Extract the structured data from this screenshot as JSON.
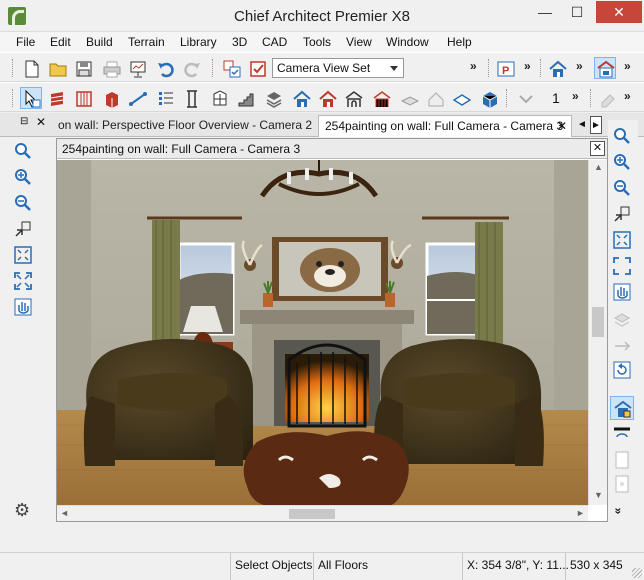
{
  "window": {
    "title": "Chief Architect Premier X8",
    "minimize": "—",
    "maximize": "☐",
    "close": "✕"
  },
  "menu": [
    "File",
    "Edit",
    "Build",
    "Terrain",
    "Library",
    "3D",
    "CAD",
    "Tools",
    "View",
    "Window",
    "Help"
  ],
  "toolbar": {
    "camera_view_set": "Camera View Set",
    "overflow": "»",
    "number": "1"
  },
  "tabs": {
    "tab1_label": "on wall: Perspective Floor Overview - Camera 2",
    "tab2_label": "254painting on wall: Full Camera - Camera 3",
    "tab2_close": "✕",
    "prev": "◄",
    "next": "►",
    "pin": "⊟",
    "panel_close": "✕"
  },
  "view": {
    "title": "254painting on wall: Full Camera - Camera 3",
    "close": "✕"
  },
  "status": {
    "mode": "Select Objects",
    "floors": "All Floors",
    "coords": "X: 354 3/8\", Y: 11...",
    "size": "530 x 345"
  },
  "icons": {
    "settings": "⚙"
  },
  "colors": {
    "selected_bg": "#cce4f7",
    "selected_border": "#7eb4ea",
    "icon_blue": "#2a6db5",
    "icon_red": "#c0392b",
    "close_red": "#c7463a"
  }
}
